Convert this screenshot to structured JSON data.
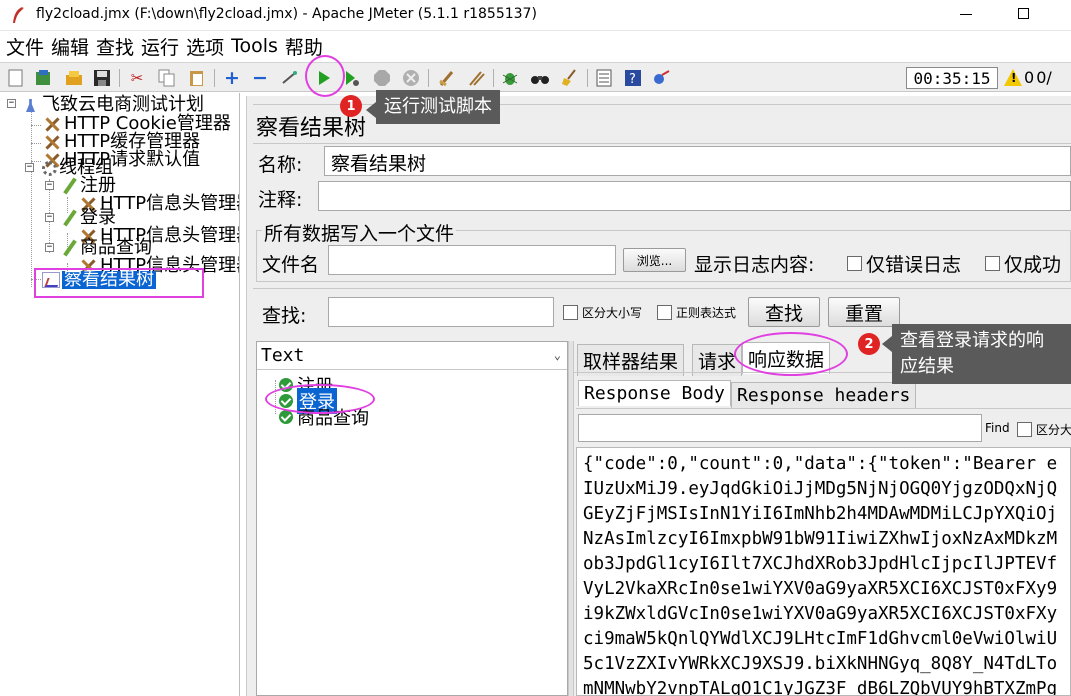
{
  "window": {
    "title": "fly2cload.jmx (F:\\down\\fly2cload.jmx) - Apache JMeter (5.1.1 r1855137)"
  },
  "menu": [
    "文件",
    "编辑",
    "查找",
    "运行",
    "选项",
    "Tools",
    "帮助"
  ],
  "toolbar": {
    "timer": "00:35:15",
    "warning_count": "0",
    "threads": "0/"
  },
  "tree": {
    "root": "飞致云电商测试计划",
    "items": [
      {
        "label": "HTTP Cookie管理器",
        "icon": "wrench-icon"
      },
      {
        "label": "HTTP缓存管理器",
        "icon": "wrench-icon"
      },
      {
        "label": "HTTP请求默认值",
        "icon": "wrench-icon"
      },
      {
        "label": "线程组",
        "icon": "gear-icon"
      },
      {
        "label": "注册",
        "icon": "sampler-icon"
      },
      {
        "label": "HTTP信息头管理器",
        "icon": "wrench-icon"
      },
      {
        "label": "登录",
        "icon": "sampler-icon"
      },
      {
        "label": "HTTP信息头管理器",
        "icon": "wrench-icon"
      },
      {
        "label": "商品查询",
        "icon": "sampler-icon"
      },
      {
        "label": "HTTP信息头管理器",
        "icon": "wrench-icon"
      },
      {
        "label": "察看结果树",
        "icon": "listener-icon"
      }
    ]
  },
  "panel": {
    "title": "察看结果树",
    "name_label": "名称:",
    "name_value": "察看结果树",
    "comment_label": "注释:",
    "comment_value": "",
    "file_group_title": "所有数据写入一个文件",
    "file_label": "文件名",
    "file_value": "",
    "browse_label": "浏览...",
    "log_label": "显示日志内容:",
    "errors_only": "仅错误日志",
    "success_only": "仅成功",
    "search_label": "查找:",
    "search_value": "",
    "case_sensitive": "区分大小写",
    "regex": "正则表达式",
    "search_button": "查找",
    "reset_button": "重置"
  },
  "results": {
    "renderer": "Text",
    "samples": [
      "注册",
      "登录",
      "商品查询"
    ],
    "tabs": [
      "取样器结果",
      "请求",
      "响应数据"
    ],
    "sub_tabs": [
      "Response Body",
      "Response headers"
    ],
    "find_label": "Find",
    "find_case": "区分大",
    "body_lines": [
      "{\"code\":0,\"count\":0,\"data\":{\"token\":\"Bearer e",
      "IUzUxMiJ9.eyJqdGkiOiJjMDg5NjNjOGQ0YjgzODQxNjQ",
      "GEyZjFjMSIsInN1YiI6ImNhb2h4MDAwMDMiLCJpYXQiOj",
      "NzAsImlzcyI6ImxpbW91bW91IiwiZXhwIjoxNzAxMDkzM",
      "ob3JpdGl1cyI6Ilt7XCJhdXRob3JpdHlcIjpcIlJPTEVf",
      "VyL2VkaXRcIn0se1wiYXV0aG9yaXR5XCI6XCJST0xFXy9",
      "i9kZWxldGVcIn0se1wiYXV0aG9yaXR5XCI6XCJST0xFXy",
      "ci9maW5kQnlQYWdlXCJ9LHtcImF1dGhvcml0eVwiOlwiU",
      "5c1VzZXIvYWRkXCJ9XSJ9.biXkNHNGyq_8Q8Y_N4TdLTo",
      "mNMNwbY2vnpTALqO1C1yJGZ3F_dB6LZQbVUY9hBTXZmPg"
    ]
  },
  "annotations": {
    "step1_number": "1",
    "step1_text": "运行测试脚本",
    "step2_number": "2",
    "step2_text_line1": "查看登录请求的响",
    "step2_text_line2": "应结果"
  },
  "colors": {
    "selection": "#0a64d2",
    "highlight": "#e040e0",
    "badge": "#e02424",
    "callout": "#5a5a5a",
    "success": "#2f9a3a"
  }
}
